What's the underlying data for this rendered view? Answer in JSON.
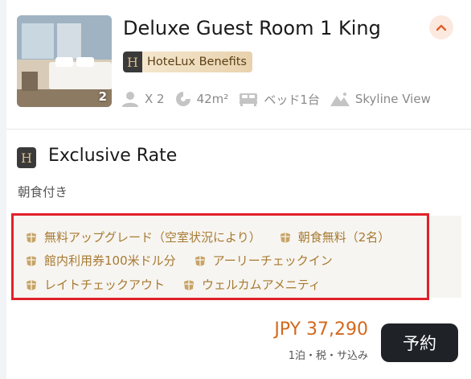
{
  "room": {
    "title": "Deluxe Guest Room 1 King",
    "photo_count": "2",
    "benefit_logo": "H",
    "benefit_label": "HoteLux Benefits",
    "amenities": {
      "guests": "X 2",
      "size": "42m²",
      "bed": "ベッド1台",
      "view": "Skyline View"
    }
  },
  "rate": {
    "logo": "H",
    "title": "Exclusive Rate",
    "meal_note": "朝食付き",
    "perks_row1": [
      "無料アップグレード（空室状況により）",
      "朝食無料（2名）"
    ],
    "perks_row2": [
      "館内利用券100米ドル分",
      "アーリーチェックイン"
    ],
    "perks_row3": [
      "レイトチェックアウト",
      "ウェルカムアメニティ"
    ]
  },
  "price": {
    "amount": "JPY 37,290",
    "note": "1泊・税・サ込み"
  },
  "book_label": "予約",
  "colors": {
    "accent_orange": "#d2691e",
    "perk_gold": "#a77a32",
    "highlight_red": "#e0212b",
    "button_dark": "#1f2328"
  },
  "icons": {
    "collapse": "chevron-up-icon",
    "guests": "person-icon",
    "size": "area-pie-icon",
    "bed": "bed-icon",
    "view": "mountain-icon",
    "perk": "leaf-gift-icon"
  }
}
